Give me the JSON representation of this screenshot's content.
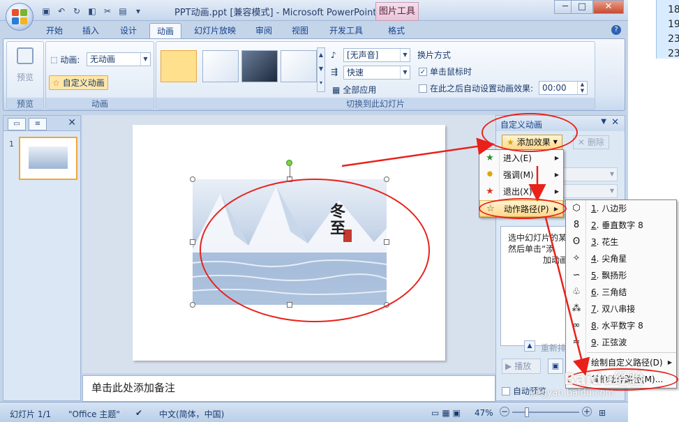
{
  "window": {
    "title": "PPT动画.ppt [兼容模式] - Microsoft PowerPoint",
    "contextual_tab": "图片工具"
  },
  "tabs": [
    "开始",
    "插入",
    "设计",
    "动画",
    "幻灯片放映",
    "审阅",
    "视图",
    "开发工具",
    "格式"
  ],
  "active_tab": "动画",
  "ribbon": {
    "preview_label": "预览",
    "preview_group": "预览",
    "animation_label": "动画:",
    "animation_value": "无动画",
    "custom_animation": "自定义动画",
    "animation_group": "动画",
    "sound_value": "[无声音]",
    "speed_value": "快速",
    "apply_all": "全部应用",
    "transition_method": "换片方式",
    "on_click": "单击鼠标时",
    "after_auto": "在此之后自动设置动画效果:",
    "time_value": "00:00",
    "transition_group": "切换到此幻灯片"
  },
  "left_pane": {
    "slide_number": "1"
  },
  "slide": {
    "title_text": "冬至"
  },
  "notes_placeholder": "单击此处添加备注",
  "task_pane": {
    "title": "自定义动画",
    "add_effect": "添加效果",
    "remove": "删除",
    "hint_line1": "选中幻灯片的某",
    "hint_line2": "然后单击“添",
    "hint_line3": "加动画",
    "reorder": "重新排",
    "play": "播放",
    "auto_preview": "自动预览"
  },
  "effect_menu": [
    {
      "label": "进入(E)",
      "icon": "enter-star-icon",
      "color": "#2e8b2e"
    },
    {
      "label": "强调(M)",
      "icon": "emphasis-star-icon",
      "color": "#d9a400"
    },
    {
      "label": "退出(X)",
      "icon": "exit-star-icon",
      "color": "#d23a1a"
    },
    {
      "label": "动作路径(P)",
      "icon": "motion-path-star-icon",
      "color": "#ffffff"
    }
  ],
  "path_menu": [
    {
      "num": "1",
      "label": "八边形",
      "icon": "octagon-icon"
    },
    {
      "num": "2",
      "label": "垂直数字 8",
      "icon": "vertical-eight-icon"
    },
    {
      "num": "3",
      "label": "花生",
      "icon": "peanut-icon"
    },
    {
      "num": "4",
      "label": "尖角星",
      "icon": "pointed-star-icon"
    },
    {
      "num": "5",
      "label": "飘扬形",
      "icon": "wave-flag-icon"
    },
    {
      "num": "6",
      "label": "三角结",
      "icon": "triangle-knot-icon"
    },
    {
      "num": "7",
      "label": "双八串接",
      "icon": "double-eight-icon"
    },
    {
      "num": "8",
      "label": "水平数字 8",
      "icon": "horizontal-eight-icon"
    },
    {
      "num": "9",
      "label": "正弦波",
      "icon": "sine-wave-icon"
    }
  ],
  "path_menu_extra": {
    "draw_custom": "绘制自定义路径(D)",
    "other_paths": "其他动作路径(M)..."
  },
  "statusbar": {
    "slide_info": "幻灯片 1/1",
    "theme": "\"Office 主题\"",
    "language": "中文(简体，中国)",
    "zoom": "47%"
  },
  "desktop_numbers": [
    "18",
    "19",
    "23",
    "23"
  ],
  "watermark": {
    "brand": "Baidu经验",
    "url": "jingyan.baidu.com"
  },
  "colors": {
    "annotation_red": "#e8211a",
    "highlight_orange": "#ffd88a",
    "ribbon_blue": "#c4d5ea"
  }
}
